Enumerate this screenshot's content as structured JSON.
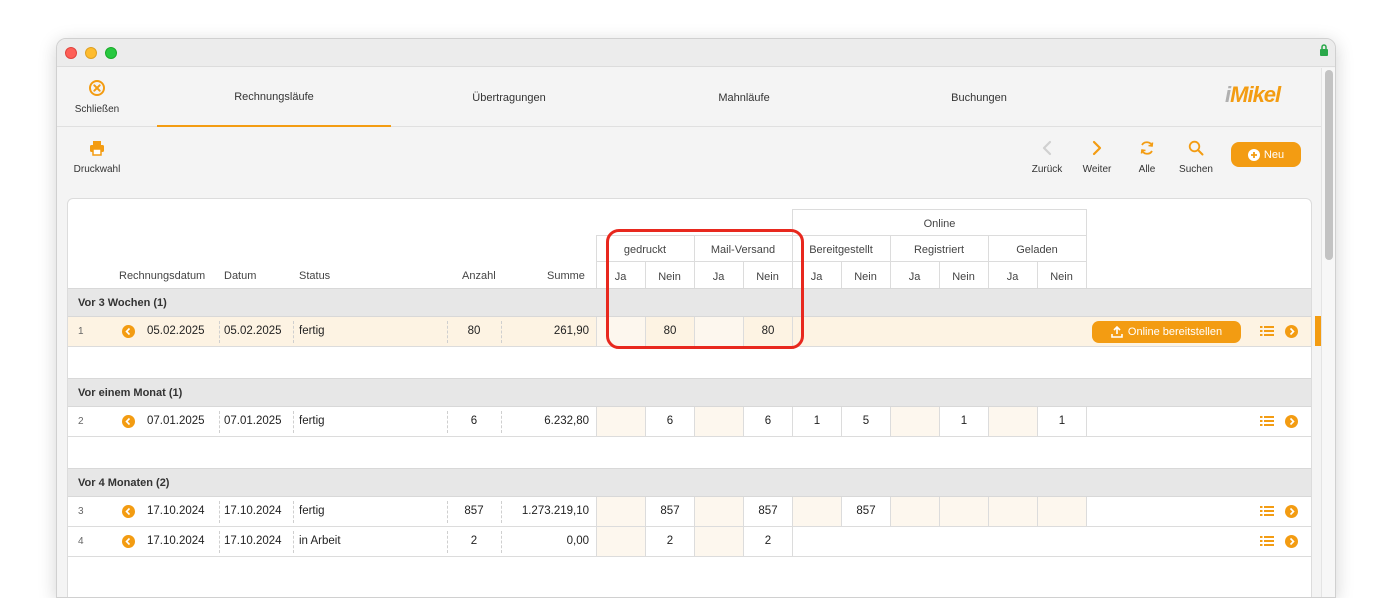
{
  "nav": {
    "close_label": "Schließen",
    "tabs": [
      {
        "label": "Rechnungsläufe"
      },
      {
        "label": "Übertragungen"
      },
      {
        "label": "Mahnläufe"
      },
      {
        "label": "Buchungen"
      }
    ],
    "logo_prefix": "i",
    "logo_text": "Mikel"
  },
  "toolbar": {
    "print_label": "Druckwahl",
    "back_label": "Zurück",
    "next_label": "Weiter",
    "all_label": "Alle",
    "search_label": "Suchen",
    "new_label": "Neu"
  },
  "table": {
    "headers": {
      "rechnungsdatum": "Rechnungsdatum",
      "datum": "Datum",
      "status": "Status",
      "anzahl": "Anzahl",
      "summe": "Summe",
      "gedruckt": "gedruckt",
      "mail": "Mail-Versand",
      "online": "Online",
      "bereitgestellt": "Bereitgestellt",
      "registriert": "Registriert",
      "geladen": "Geladen",
      "ja": "Ja",
      "nein": "Nein"
    },
    "groups": [
      {
        "label": "Vor 3 Wochen (1)"
      },
      {
        "label": "Vor einem Monat (1)"
      },
      {
        "label": "Vor 4 Monaten (2)"
      }
    ],
    "rows": [
      {
        "nr": "1",
        "rechnungsdatum": "05.02.2025",
        "datum": "05.02.2025",
        "status": "fertig",
        "anzahl": "80",
        "summe": "261,90",
        "gedruckt_ja": "",
        "gedruckt_nein": "80",
        "mail_ja": "",
        "mail_nein": "80",
        "action": "Online bereitstellen"
      },
      {
        "nr": "2",
        "rechnungsdatum": "07.01.2025",
        "datum": "07.01.2025",
        "status": "fertig",
        "anzahl": "6",
        "summe": "6.232,80",
        "gedruckt_ja": "",
        "gedruckt_nein": "6",
        "mail_ja": "",
        "mail_nein": "6",
        "bereit_ja": "1",
        "bereit_nein": "5",
        "reg_ja": "",
        "reg_nein": "1",
        "gel_ja": "",
        "gel_nein": "1"
      },
      {
        "nr": "3",
        "rechnungsdatum": "17.10.2024",
        "datum": "17.10.2024",
        "status": "fertig",
        "anzahl": "857",
        "summe": "1.273.219,10",
        "gedruckt_ja": "",
        "gedruckt_nein": "857",
        "mail_ja": "",
        "mail_nein": "857",
        "bereit_ja": "",
        "bereit_nein": "857",
        "reg_ja": "",
        "reg_nein": "",
        "gel_ja": "",
        "gel_nein": ""
      },
      {
        "nr": "4",
        "rechnungsdatum": "17.10.2024",
        "datum": "17.10.2024",
        "status": "in Arbeit",
        "anzahl": "2",
        "summe": "0,00",
        "gedruckt_ja": "",
        "gedruckt_nein": "2",
        "mail_ja": "",
        "mail_nein": "2"
      }
    ]
  },
  "colors": {
    "accent": "#f39c12",
    "highlight": "#e8281e"
  }
}
